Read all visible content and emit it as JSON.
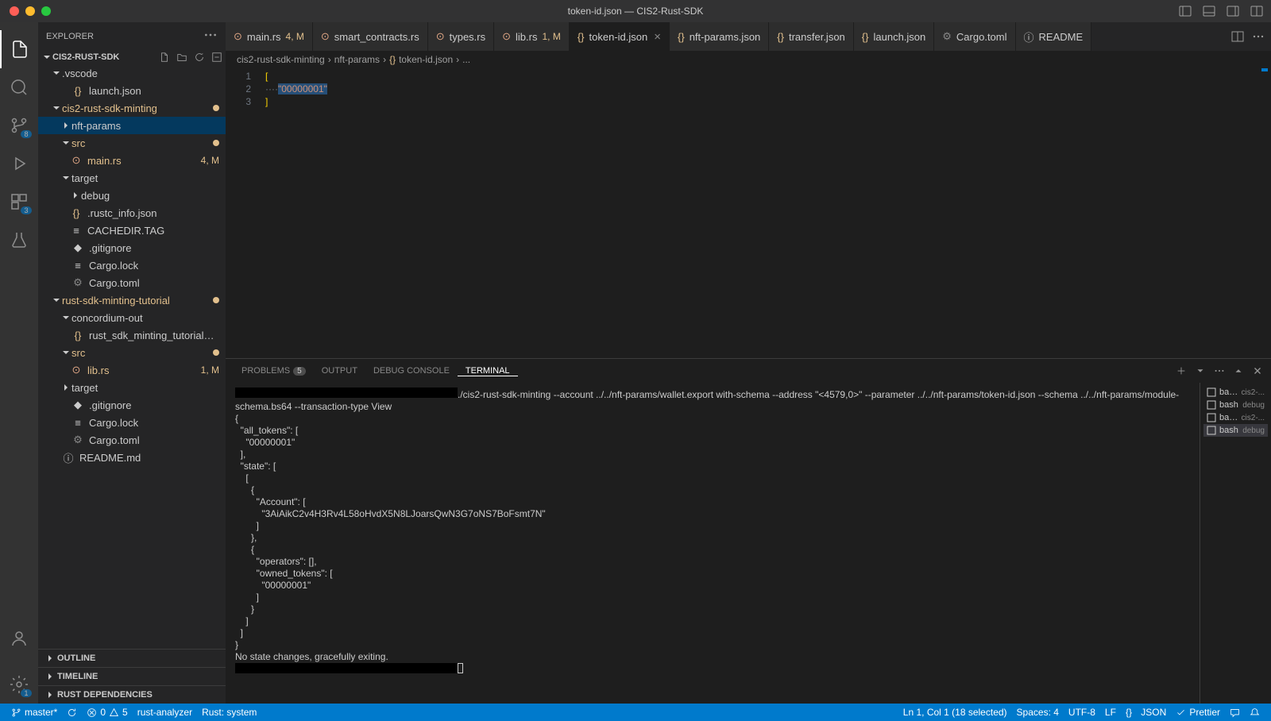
{
  "title": "token-id.json — CIS2-Rust-SDK",
  "sidebar": {
    "title": "EXPLORER",
    "project": "CIS2-RUST-SDK",
    "sections": [
      "OUTLINE",
      "TIMELINE",
      "RUST DEPENDENCIES"
    ]
  },
  "activity": {
    "git_badge": "8",
    "ext_badge": "3",
    "settings_badge": "1"
  },
  "tree": {
    "vscode": ".vscode",
    "launch": "launch.json",
    "minting": "cis2-rust-sdk-minting",
    "nftparams": "nft-params",
    "src": "src",
    "mainrs": "main.rs",
    "mainrs_dec": "4, M",
    "target": "target",
    "debug": "debug",
    "rustc": ".rustc_info.json",
    "cachedir": "CACHEDIR.TAG",
    "gitignore": ".gitignore",
    "cargolock": "Cargo.lock",
    "cargotoml": "Cargo.toml",
    "tutorial": "rust-sdk-minting-tutorial",
    "concordium": "concordium-out",
    "schema": "rust_sdk_minting_tutorial_schema.json",
    "librs": "lib.rs",
    "librs_dec": "1, M",
    "readme": "README.md"
  },
  "tabs": [
    {
      "label": "main.rs",
      "icon": "rust",
      "dec": "4, M"
    },
    {
      "label": "smart_contracts.rs",
      "icon": "rust"
    },
    {
      "label": "types.rs",
      "icon": "rust"
    },
    {
      "label": "lib.rs",
      "icon": "rust",
      "dec": "1, M"
    },
    {
      "label": "token-id.json",
      "icon": "json",
      "active": true,
      "close": true
    },
    {
      "label": "nft-params.json",
      "icon": "json"
    },
    {
      "label": "transfer.json",
      "icon": "json"
    },
    {
      "label": "launch.json",
      "icon": "json"
    },
    {
      "label": "Cargo.toml",
      "icon": "toml"
    },
    {
      "label": "README",
      "icon": "info"
    }
  ],
  "breadcrumbs": [
    "cis2-rust-sdk-minting",
    "nft-params",
    "token-id.json",
    "..."
  ],
  "code": {
    "lines": [
      "1",
      "2",
      "3"
    ],
    "content": [
      "[",
      "····\"00000001\"",
      "]"
    ]
  },
  "panel": {
    "tabs": {
      "problems": "PROBLEMS",
      "problems_badge": "5",
      "output": "OUTPUT",
      "debug": "DEBUG CONSOLE",
      "terminal": "TERMINAL"
    }
  },
  "terminal": {
    "output": "./cis2-rust-sdk-minting --account ../../nft-params/wallet.export with-schema --address \"<4579,0>\" --parameter ../../nft-params/token-id.json --schema ../../nft-params/module-schema.bs64 --transaction-type View\n{\n  \"all_tokens\": [\n    \"00000001\"\n  ],\n  \"state\": [\n    [\n      {\n        \"Account\": [\n          \"3AiAikC2v4H3Rv4L58oHvdX5N8LJoarsQwN3G7oNS7BoFsmt7N\"\n        ]\n      },\n      {\n        \"operators\": [],\n        \"owned_tokens\": [\n          \"00000001\"\n        ]\n      }\n    ]\n  ]\n}\nNo state changes, gracefully exiting.",
    "sessions": [
      {
        "name": "bash",
        "tag": "cis2-..."
      },
      {
        "name": "bash",
        "tag": "debug"
      },
      {
        "name": "bash",
        "tag": "cis2-..."
      },
      {
        "name": "bash",
        "tag": "debug",
        "active": true
      }
    ]
  },
  "status": {
    "branch": "master*",
    "errors": "0",
    "warnings": "5",
    "analyzer": "rust-analyzer",
    "rust": "Rust: system",
    "position": "Ln 1, Col 1 (18 selected)",
    "spaces": "Spaces: 4",
    "encoding": "UTF-8",
    "eol": "LF",
    "lang": "JSON",
    "prettier": "Prettier"
  }
}
